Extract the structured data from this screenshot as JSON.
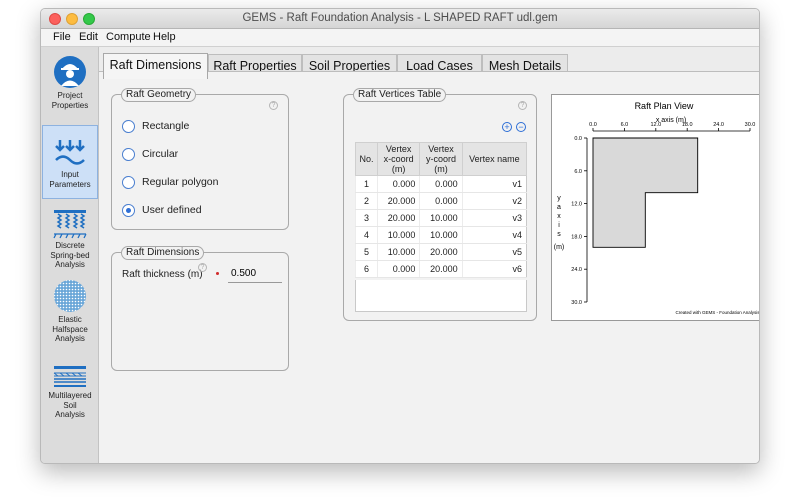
{
  "window": {
    "title": "GEMS - Raft Foundation Analysis - L SHAPED RAFT udl.gem"
  },
  "menu": [
    "File",
    "Edit",
    "Compute",
    "Help"
  ],
  "sidebar": {
    "items": [
      {
        "label1": "Project",
        "label2": "Properties",
        "icon": "engineer-icon"
      },
      {
        "label1": "Input",
        "label2": "Parameters",
        "icon": "input-arrows-icon"
      },
      {
        "label1": "Discrete",
        "label2": "Spring-bed",
        "label3": "Analysis",
        "icon": "spring-bed-icon"
      },
      {
        "label1": "Elastic",
        "label2": "Halfspace",
        "label3": "Analysis",
        "icon": "halfspace-icon"
      },
      {
        "label1": "Multilayered Soil",
        "label2": "Analysis",
        "icon": "layers-icon"
      }
    ]
  },
  "tabs": [
    "Raft Dimensions",
    "Raft Properties",
    "Soil Properties",
    "Load Cases",
    "Mesh Details"
  ],
  "geometry": {
    "title": "Raft Geometry",
    "options": [
      "Rectangle",
      "Circular",
      "Regular polygon",
      "User defined"
    ],
    "selected": "User defined"
  },
  "dimensions": {
    "title": "Raft Dimensions",
    "thickness_label": "Raft thickness (m)",
    "thickness_value": "0.500"
  },
  "vertices": {
    "title": "Raft Vertices Table",
    "plus": "+",
    "minus": "−",
    "headers": {
      "no": "No.",
      "x1": "Vertex",
      "x2": "x-coord",
      "x3": "(m)",
      "y1": "Vertex",
      "y2": "y-coord",
      "y3": "(m)",
      "name": "Vertex name"
    },
    "rows": [
      {
        "no": "1",
        "x": "0.000",
        "y": "0.000",
        "name": "v1"
      },
      {
        "no": "2",
        "x": "20.000",
        "y": "0.000",
        "name": "v2"
      },
      {
        "no": "3",
        "x": "20.000",
        "y": "10.000",
        "name": "v3"
      },
      {
        "no": "4",
        "x": "10.000",
        "y": "10.000",
        "name": "v4"
      },
      {
        "no": "5",
        "x": "10.000",
        "y": "20.000",
        "name": "v5"
      },
      {
        "no": "6",
        "x": "0.000",
        "y": "20.000",
        "name": "v6"
      }
    ]
  },
  "chart_data": {
    "type": "area",
    "title": "Raft Plan View",
    "xlabel": "x axis (m)",
    "ylabel_letters": [
      "y",
      "a",
      "x",
      "i",
      "s"
    ],
    "ylabel_unit": "(m)",
    "xticks": [
      "0.0",
      "6.0",
      "12.0",
      "18.0",
      "24.0",
      "30.0"
    ],
    "yticks": [
      "0.0",
      "6.0",
      "12.0",
      "18.0",
      "24.0",
      "30.0"
    ],
    "xlim": [
      0,
      30
    ],
    "ylim": [
      0,
      30
    ],
    "y_inverted": true,
    "polygon": [
      [
        0,
        0
      ],
      [
        20,
        0
      ],
      [
        20,
        10
      ],
      [
        10,
        10
      ],
      [
        10,
        20
      ],
      [
        0,
        20
      ]
    ],
    "fill": "#d9d9d9",
    "credit": "Created with GEMS - Foundation Analysis Suite"
  }
}
